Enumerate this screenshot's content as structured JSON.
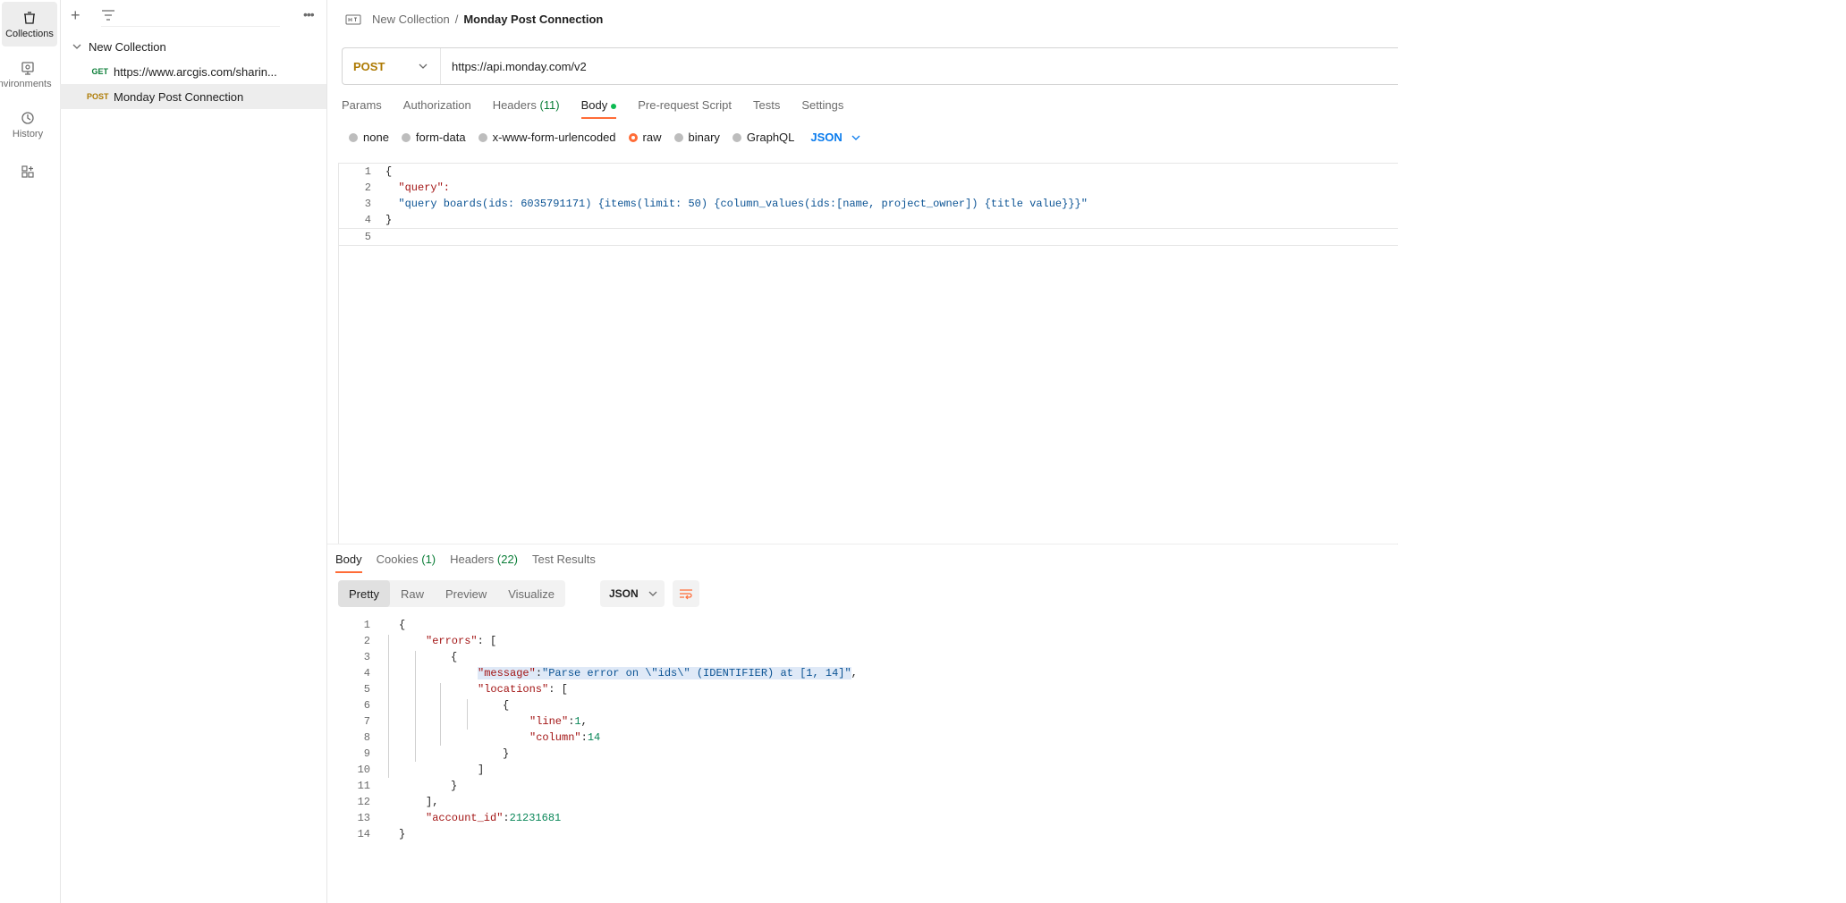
{
  "rail": {
    "items": [
      {
        "label": "Collections",
        "icon": "trash-icon"
      },
      {
        "label": "Environments",
        "icon": "environment-icon"
      },
      {
        "label": "History",
        "icon": "history-icon"
      },
      {
        "label": "",
        "icon": "apps-icon"
      }
    ]
  },
  "sidebar": {
    "collection_name": "New Collection",
    "requests": [
      {
        "method": "GET",
        "name": "https://www.arcgis.com/sharin..."
      },
      {
        "method": "POST",
        "name": "Monday Post Connection"
      }
    ]
  },
  "breadcrumb": {
    "parent": "New Collection",
    "sep": "/",
    "current": "Monday Post Connection"
  },
  "request": {
    "method": "POST",
    "url": "https://api.monday.com/v2",
    "tabs": [
      "Params",
      "Authorization",
      "Headers",
      "Body",
      "Pre-request Script",
      "Tests",
      "Settings"
    ],
    "headers_count": "(11)",
    "body_modes": [
      "none",
      "form-data",
      "x-www-form-urlencoded",
      "raw",
      "binary",
      "GraphQL"
    ],
    "body_mode_selected": "raw",
    "language": "JSON",
    "body_lines": [
      "{",
      "  \"query\":  ",
      "  \"query boards(ids: 6035791171) {items(limit: 50) {column_values(ids:[name, project_owner]) {title value}}}\"",
      "}",
      ""
    ],
    "line_numbers": [
      "1",
      "2",
      "3",
      "4",
      "5"
    ]
  },
  "response": {
    "tabs": [
      "Body",
      "Cookies",
      "Headers",
      "Test Results"
    ],
    "cookies_count": "(1)",
    "headers_count": "(22)",
    "views": [
      "Pretty",
      "Raw",
      "Preview",
      "Visualize"
    ],
    "format": "JSON",
    "line_numbers": [
      "1",
      "2",
      "3",
      "4",
      "5",
      "6",
      "7",
      "8",
      "9",
      "10",
      "11",
      "12",
      "13",
      "14"
    ],
    "lines": {
      "l1": "{",
      "l2_key": "\"errors\"",
      "l2_rest": ": [",
      "l3": "{",
      "l4_key": "\"message\"",
      "l4_colon": ": ",
      "l4_val": "\"Parse error on \\\"ids\\\" (IDENTIFIER) at [1, 14]\"",
      "l4_end": ",",
      "l5_key": "\"locations\"",
      "l5_rest": ": [",
      "l6": "{",
      "l7_key": "\"line\"",
      "l7_colon": ": ",
      "l7_val": "1",
      "l7_end": ",",
      "l8_key": "\"column\"",
      "l8_colon": ": ",
      "l8_val": "14",
      "l9": "}",
      "l10": "]",
      "l11": "}",
      "l12": "],",
      "l13_key": "\"account_id\"",
      "l13_colon": ": ",
      "l13_val": "21231681",
      "l14": "}"
    }
  }
}
